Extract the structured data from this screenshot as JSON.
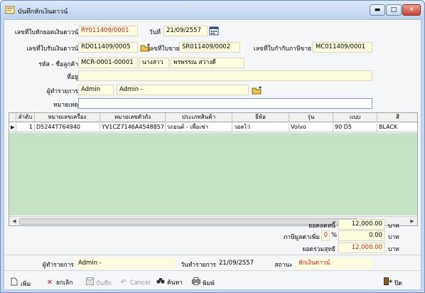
{
  "window": {
    "title": "บันทึกหักเงินดาวน์",
    "minimize": "▬",
    "maximize": "□",
    "close": "✕"
  },
  "form": {
    "deduct_no_label": "เลขที่ใบหักยอดเงินดาวน์",
    "deduct_no": "RY011409/0001",
    "date_label": "วันที่",
    "date": "21/09/2557",
    "receipt_no_label": "เลขที่ใบรับเงินดาวน์",
    "receipt_no": "RD011409/0005",
    "sale_no_label": "เลขที่ใบขาย",
    "sale_no": "SR011409/0002",
    "tax_invoice_label": "เลขที่ใบกำกับภาษีขาย",
    "tax_invoice_no": "MC011409/0001",
    "customer_label": "รหัส - ชื่อลูกค้า",
    "customer_code": "MCR-0001-00001",
    "customer_title": "นางสาว",
    "customer_name": "พรพรรณ สว่างดี",
    "address_label": "ที่อยู่",
    "address": "",
    "operator_label": "ผู้ทำรายการ",
    "operator_code": "Admin",
    "operator_name": "Admin -",
    "note_label": "หมายเหตุ",
    "note": ""
  },
  "grid": {
    "columns": [
      "ลำดับ",
      "หมายเลขเครื่อง",
      "หมายเลขตัวถัง",
      "ประเภทสินค้า",
      "ยี่ห้อ",
      "รุ่น",
      "แบบ",
      "สี"
    ],
    "rows": [
      {
        "marker": "▶",
        "no": "1",
        "engine": "D5244T764940",
        "chassis": "YV1CZ7146A4548857",
        "type": "รถยนต์ - เพื่อเช่า",
        "brand": "วอลโว่",
        "model": "Volvo",
        "style": "90 D5",
        "color": "BLACK"
      }
    ]
  },
  "totals": {
    "outstanding_label": "ยอดลดหนี้",
    "outstanding": "12,000.00",
    "outstanding_unit": "บาท",
    "vat_label": "ภาษีมูลค่าเพิ่ม",
    "vat_rate": "0",
    "vat_pct": "%",
    "vat_amount": "0.00",
    "vat_unit": "บาท",
    "net_label": "ยอดรวมสุทธิ",
    "net": "12,000.00",
    "net_unit": "บาท"
  },
  "status": {
    "operator_label": "ผู้ทำรายการ",
    "operator": "Admin -",
    "date_label": "วันทำรายการ",
    "date": "21/09/2557",
    "state_label": "สถานะ",
    "state": "หักเงินดาวน์"
  },
  "toolbar": {
    "add": "เพิ่ม",
    "cancel_edit": "ยกเลิก",
    "save": "บันทึก",
    "cancel": "Cancel",
    "search": "ค้นหา",
    "print": "พิมพ์",
    "close": "ปิด"
  },
  "colors": {
    "accent_red": "#e01b1b",
    "field_bg": "#fffde0",
    "grid_empty_bg": "#c7e3c6"
  },
  "icons": [
    "app-icon",
    "calendar-icon",
    "lookup-icon",
    "new-doc-icon",
    "delete-x-icon",
    "save-icon",
    "undo-icon",
    "binoculars-icon",
    "printer-icon",
    "exit-icon"
  ]
}
